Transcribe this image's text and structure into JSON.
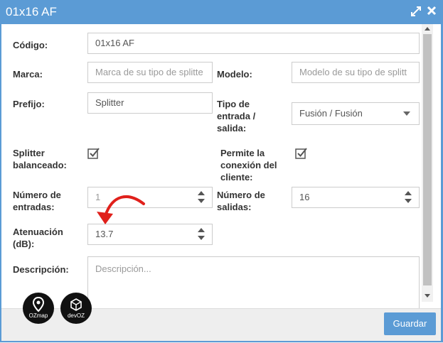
{
  "dialog": {
    "title": "01x16 AF"
  },
  "fields": {
    "codigo": {
      "label": "Código:",
      "value": "01x16 AF"
    },
    "marca": {
      "label": "Marca:",
      "placeholder": "Marca de su tipo de splitte"
    },
    "modelo": {
      "label": "Modelo:",
      "placeholder": "Modelo de su tipo de splitt"
    },
    "prefijo": {
      "label": "Prefijo:",
      "value": "Splitter"
    },
    "tipo": {
      "label_lines": [
        "Tipo de",
        "entrada /",
        "salida:"
      ],
      "value": "Fusión / Fusión"
    },
    "balanceado": {
      "label_lines": [
        "Splitter",
        "balanceado:"
      ],
      "checked": true
    },
    "permite": {
      "label_lines": [
        "Permite la",
        "conexión del",
        "cliente:"
      ],
      "checked": true
    },
    "entradas": {
      "label_lines": [
        "Número de",
        "entradas:"
      ],
      "value": "1"
    },
    "salidas": {
      "label_lines": [
        "Número de",
        "salidas:"
      ],
      "value": "16"
    },
    "atenuacion": {
      "label_lines": [
        "Atenuación",
        "(dB):"
      ],
      "value": "13.7"
    },
    "descripcion": {
      "label": "Descripción:",
      "placeholder": "Descripción..."
    }
  },
  "footer": {
    "save_label": "Guardar"
  },
  "logos": {
    "ozmap": "OZmap",
    "devoz": "devOZ"
  },
  "colors": {
    "accent": "#5b9bd5",
    "annotation": "#e0201b"
  },
  "icons": {
    "maximize": "expand-icon",
    "close": "close-icon"
  }
}
